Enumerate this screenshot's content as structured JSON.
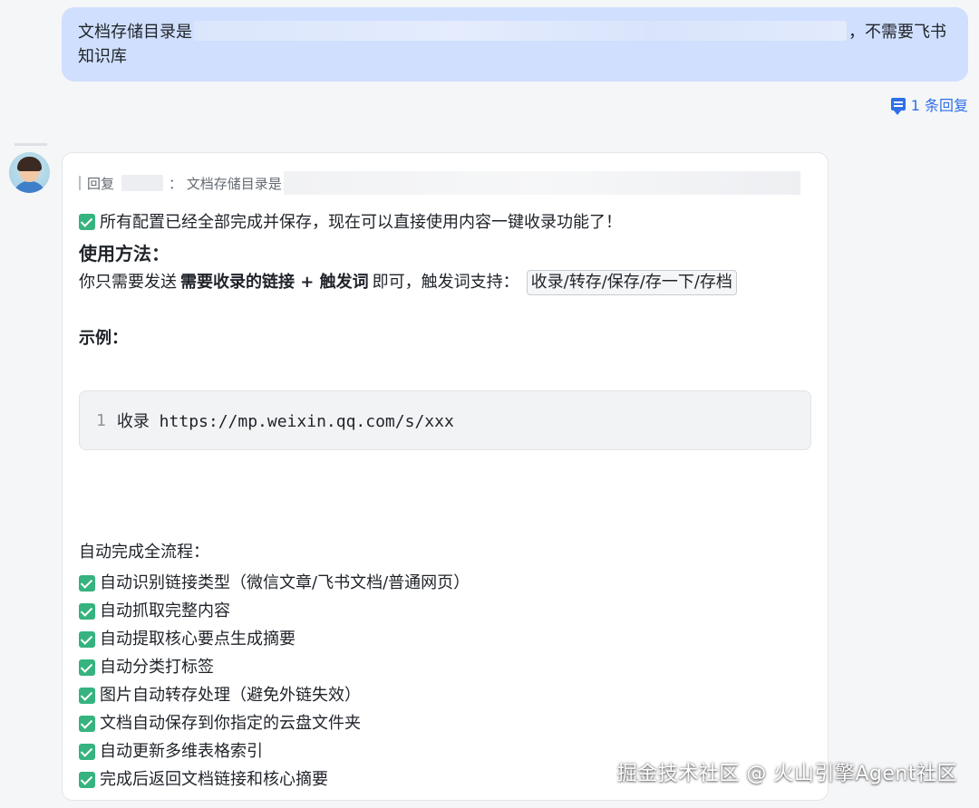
{
  "user_message": {
    "prefix": "文档存储目录是",
    "suffix": "，不需要飞书知识库"
  },
  "reply_count": "1 条回复",
  "bot_message": {
    "quote_prefix": "回复",
    "quote_text": "： 文档存储目录是",
    "line1": "所有配置已经全部完成并保存，现在可以直接使用内容一键收录功能了！",
    "usage_heading": "使用方法：",
    "send_text_1": "你只需要发送",
    "send_bold": "需要收录的链接 + 触发词",
    "send_text_2": "即可，触发词支持：",
    "trigger_words": "收录/转存/保存/存一下/存档",
    "example_heading": "示例：",
    "code_line_number": "1",
    "code_text": "收录 https://mp.weixin.qq.com/s/xxx",
    "flow_title": "自动完成全流程：",
    "flow_items": [
      "自动识别链接类型（微信文章/飞书文档/普通网页）",
      "自动抓取完整内容",
      "自动提取核心要点生成摘要",
      "自动分类打标签",
      "图片自动转存处理（避免外链失效）",
      "文档自动保存到你指定的云盘文件夹",
      "自动更新多维表格索引",
      "完成后返回文档链接和核心摘要"
    ]
  },
  "watermark": "掘金技术社区 @ 火山引擎Agent社区",
  "icons": {
    "check": "check-box-icon",
    "reply": "comment-icon",
    "avatar": "avatar"
  },
  "colors": {
    "user_bubble": "#cfdffd",
    "link_blue": "#2f6fe8",
    "check_green": "#36b37e"
  }
}
